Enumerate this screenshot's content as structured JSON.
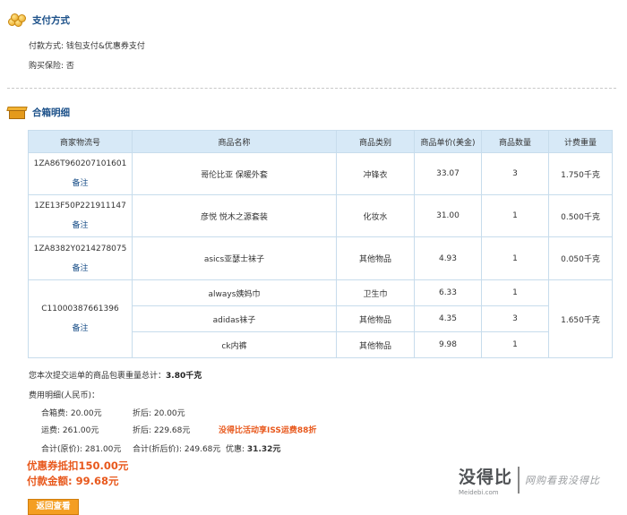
{
  "payment": {
    "title": "支付方式",
    "method_line": "付款方式: 钱包支付&优惠券支付",
    "insurance_line": "购买保险: 否"
  },
  "box": {
    "title": "合箱明细",
    "headers": [
      "商家物流号",
      "商品名称",
      "商品类别",
      "商品单价(美金)",
      "商品数量",
      "计费重量"
    ],
    "note_label": "备注",
    "groups": [
      {
        "tracking": "1ZA86T960207101601",
        "weight": "1.750千克",
        "items": [
          {
            "name": "哥伦比亚 保暖外套",
            "category": "冲锋衣",
            "price": "33.07",
            "qty": "3"
          }
        ]
      },
      {
        "tracking": "1ZE13F50P221911147",
        "weight": "0.500千克",
        "items": [
          {
            "name": "彦悦 悦木之源套装",
            "category": "化妆水",
            "price": "31.00",
            "qty": "1"
          }
        ]
      },
      {
        "tracking": "1ZA8382Y0214278075",
        "weight": "0.050千克",
        "items": [
          {
            "name": "asics亚瑟士袜子",
            "category": "其他物品",
            "price": "4.93",
            "qty": "1"
          }
        ]
      },
      {
        "tracking": "C11000387661396",
        "weight": "1.650千克",
        "items": [
          {
            "name": "always姨妈巾",
            "category": "卫生巾",
            "price": "6.33",
            "qty": "1"
          },
          {
            "name": "adidas袜子",
            "category": "其他物品",
            "price": "4.35",
            "qty": "3"
          },
          {
            "name": "ck内裤",
            "category": "其他物品",
            "price": "9.98",
            "qty": "1"
          }
        ]
      }
    ]
  },
  "summary": {
    "total_weight_label": "您本次提交运单的商品包裹重量总计：",
    "total_weight_value": "3.80千克",
    "fee_title": "费用明细(人民币)：",
    "box_fee": "合箱费:  20.00元",
    "box_fee_after": "折后:  20.00元",
    "shipping": "运费:    261.00元",
    "shipping_after": "折后:  229.68元",
    "promo": "没得比活动享ISS运费88折",
    "total_orig": "合计(原价):  281.00元",
    "total_after": "合计(折后价):  249.68元",
    "discount_label": "优惠:",
    "discount_value": "31.32元",
    "coupon": "优惠券抵扣150.00元",
    "pay_total": "付款金额:  99.68元",
    "back_button": "返回查看"
  },
  "watermark": {
    "main": "没得比",
    "sub": "Meidebi.com",
    "slogan": "网购看我没得比"
  },
  "colors": {
    "accent_blue": "#1a4f88",
    "header_bg": "#d7e9f7",
    "promo_orange": "#e8581c",
    "button": "#f49e22"
  },
  "icons": [
    "coins-icon",
    "box-icon"
  ]
}
